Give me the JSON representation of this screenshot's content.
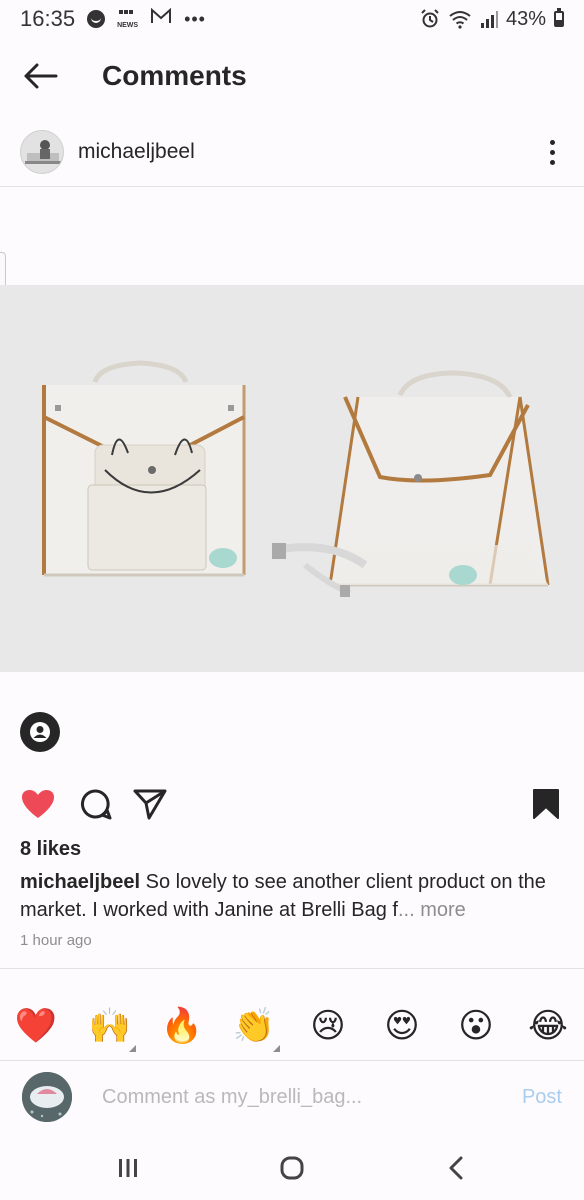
{
  "status_bar": {
    "time": "16:35",
    "news_label": "NEWS",
    "battery_percent": "43%",
    "battery_level": 0.43
  },
  "header": {
    "title": "Comments"
  },
  "post": {
    "author": "michaeljbeel",
    "likes": "8 likes",
    "caption_user": "michaeljbeel",
    "caption_text": "So lovely to see another client product on the market. I worked with Janine at Brelli Bag f",
    "caption_ellipsis": "...",
    "caption_more": "more",
    "timestamp": "1 hour ago",
    "image_bg": "#e8e8e8",
    "bag_trim_color": "#b27a3e"
  },
  "emoji_bar": {
    "emojis": [
      "❤️",
      "🙌",
      "🔥",
      "👏",
      "😢",
      "😍",
      "😮",
      "😂"
    ]
  },
  "comment": {
    "placeholder": "Comment as my_brelli_bag...",
    "post_label": "Post"
  },
  "colors": {
    "like_red": "#ed4956",
    "post_disabled_blue": "#a9cdee",
    "text_primary": "#262626",
    "text_secondary": "#8e8e8e"
  }
}
